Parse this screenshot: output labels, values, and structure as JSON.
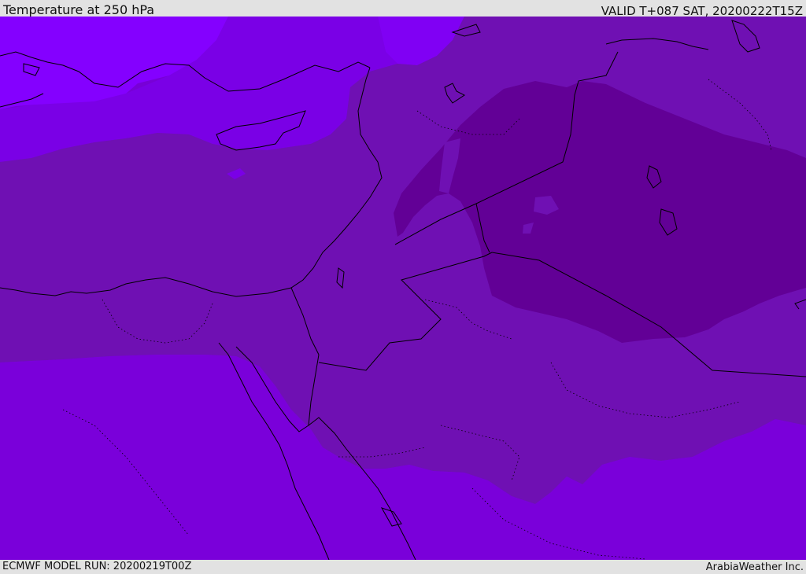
{
  "header": {
    "title": "Temperature at 250 hPa",
    "valid": "VALID T+087 SAT, 20200222T15Z"
  },
  "footer": {
    "model_run": "ECMWF MODEL RUN: 20200219T00Z",
    "credit": "ArabiaWeather Inc."
  },
  "map": {
    "field_colors": {
      "coldest": "#620096",
      "cold": "#6f10b3",
      "mid": "#7700d6",
      "warm": "#7f00f2",
      "warmest": "#8400ff"
    },
    "line_color": "#000000"
  }
}
